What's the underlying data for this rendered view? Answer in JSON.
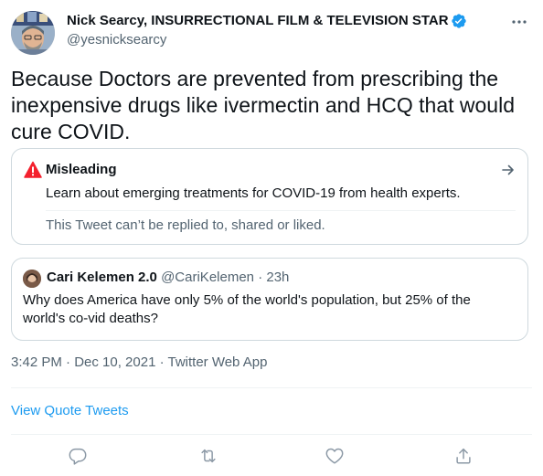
{
  "tweet": {
    "author": {
      "display_name": "Nick Searcy, INSURRECTIONAL FILM & TELEVISION STAR",
      "handle": "@yesnicksearcy",
      "verified": true
    },
    "text": "Because Doctors are prevented from prescribing the inexpensive drugs like ivermectin and HCQ that would cure COVID.",
    "warning": {
      "title": "Misleading",
      "subtitle": "Learn about emerging treatments for COVID-19 from health experts.",
      "note": "This Tweet can’t be replied to, shared or liked."
    },
    "quoted": {
      "display_name": "Cari Kelemen 2.0",
      "handle": "@CariKelemen",
      "separator": "·",
      "time": "23h",
      "text": "Why does America have only 5% of the world's population, but 25% of the world's co-vid deaths?"
    },
    "meta": "3:42 PM · Dec 10, 2021 · Twitter Web App",
    "view_quotes_label": "View Quote Tweets"
  },
  "icons": {
    "more": "more-icon",
    "verified": "verified-badge-icon",
    "warning": "warning-icon",
    "arrow": "arrow-right-icon",
    "reply": "reply-icon",
    "retweet": "retweet-icon",
    "like": "heart-icon",
    "share": "share-icon"
  },
  "colors": {
    "accent": "#1d9bf0",
    "warning": "#f4212e",
    "text_secondary": "#536471",
    "border": "#cfd9de"
  }
}
